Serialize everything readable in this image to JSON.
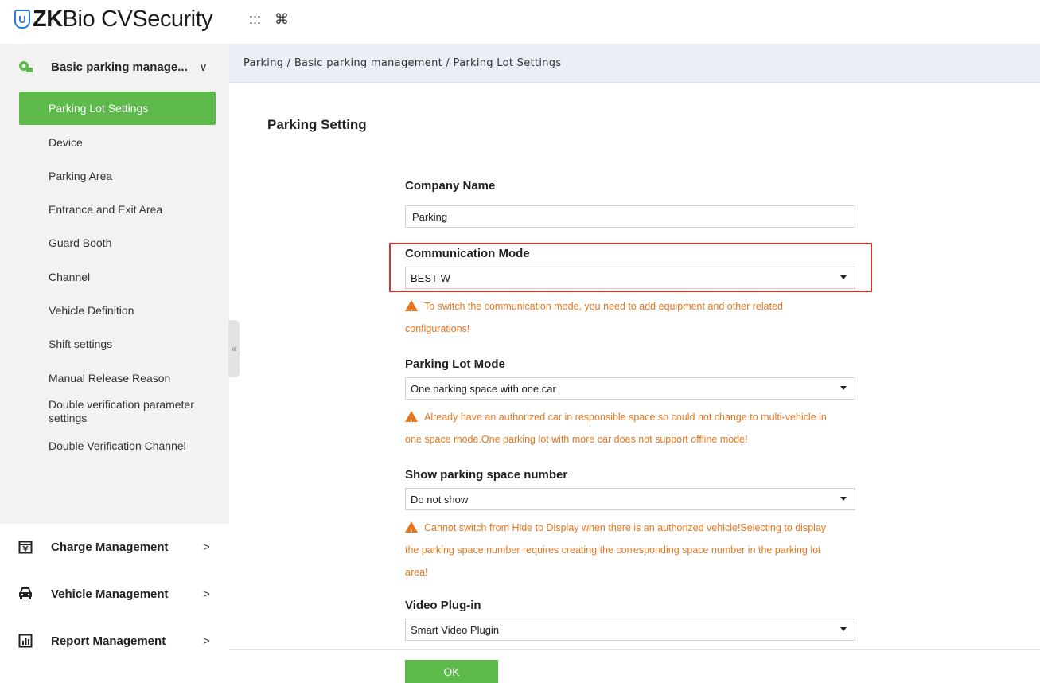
{
  "header": {
    "logo_badge": "U",
    "logo_zk": "ZK",
    "logo_bio": "Bio",
    "logo_cv": "CVSecurity",
    "apps_icon": ":::",
    "command_icon": "⌘"
  },
  "sidebar": {
    "basic_group": {
      "label": "Basic parking manage...",
      "chevron": "∨"
    },
    "items": [
      {
        "label": "Parking Lot Settings",
        "active": true
      },
      {
        "label": "Device"
      },
      {
        "label": "Parking Area"
      },
      {
        "label": "Entrance and Exit Area"
      },
      {
        "label": "Guard Booth"
      },
      {
        "label": "Channel"
      },
      {
        "label": "Vehicle Definition"
      },
      {
        "label": "Shift settings"
      },
      {
        "label": "Manual Release Reason"
      },
      {
        "label": "Double verification parameter settings"
      },
      {
        "label": "Double Verification Channel"
      }
    ],
    "groups": [
      {
        "label": "Charge Management",
        "chevron": ">"
      },
      {
        "label": "Vehicle Management",
        "chevron": ">"
      },
      {
        "label": "Report Management",
        "chevron": ">"
      }
    ],
    "collapse_icon": "«"
  },
  "breadcrumb": "Parking / Basic parking management / Parking Lot Settings",
  "page_title": "Parking Setting",
  "form": {
    "company_name": {
      "label": "Company Name",
      "value": "Parking"
    },
    "communication_mode": {
      "label": "Communication Mode",
      "value": "BEST-W",
      "warning_line1": "To switch the communication mode, you need to add equipment and other related",
      "warning_line2": "configurations!"
    },
    "parking_lot_mode": {
      "label": "Parking Lot Mode",
      "value": "One parking space with one car",
      "warning_line1": "Already have an authorized car in responsible space so could not change to multi-vehicle in",
      "warning_line2": "one space mode.One parking lot with more car does not support offline mode!"
    },
    "show_space_number": {
      "label": "Show parking space number",
      "value": "Do not show",
      "warning_line1": "Cannot switch from Hide to Display when there is an authorized vehicle!Selecting to display",
      "warning_line2": "the parking space number requires creating the corresponding space number in the parking lot",
      "warning_line3": "area!"
    },
    "video_plugin": {
      "label": "Video Plug-in",
      "value": "Smart Video Plugin"
    }
  },
  "ok_label": "OK",
  "colors": {
    "accent": "#5db94a",
    "warning": "#e8761f",
    "highlight": "#e03131"
  }
}
